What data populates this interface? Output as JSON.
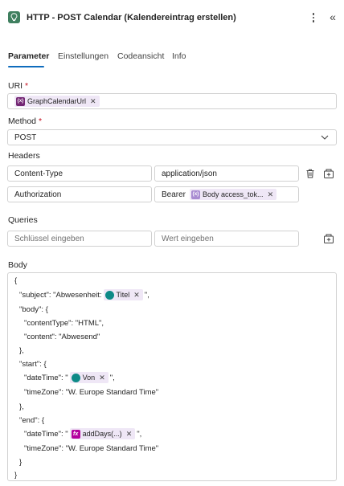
{
  "header": {
    "title": "HTTP  - POST Calendar (Kalendereintrag erstellen)",
    "action_icon": "lightbulb-icon",
    "more_icon": "more-vertical-icon",
    "collapse_glyph": "«"
  },
  "tabs": [
    {
      "label": "Parameter",
      "active": true
    },
    {
      "label": "Einstellungen",
      "active": false
    },
    {
      "label": "Codeansicht",
      "active": false
    },
    {
      "label": "Info",
      "active": false
    }
  ],
  "uri": {
    "label": "URI",
    "required_mark": "*",
    "token": {
      "label": "GraphCalendarUrl",
      "icon": "{x}"
    }
  },
  "method": {
    "label": "Method",
    "required_mark": "*",
    "value": "POST"
  },
  "headers": {
    "label": "Headers",
    "rows": [
      {
        "key": "Content-Type",
        "value": "application/json"
      },
      {
        "key": "Authorization",
        "value_prefix": "Bearer",
        "token": {
          "label": "Body access_tok...",
          "icon": "{x}"
        }
      }
    ]
  },
  "queries": {
    "label": "Queries",
    "key_placeholder": "Schlüssel eingeben",
    "value_placeholder": "Wert eingeben"
  },
  "body": {
    "label": "Body",
    "lines": {
      "l1": "{",
      "l2a": "\"subject\": \"Abwesenheit: ",
      "l2_token": "Titel",
      "l2b": " \",",
      "l3": "\"body\": {",
      "l4": "\"contentType\": \"HTML\",",
      "l5": "\"content\": \"Abwesend\"",
      "l6": "},",
      "l7": "\"start\": {",
      "l8a": "\"dateTime\": \"",
      "l8_token": "Von",
      "l8b": " \",",
      "l9": "\"timeZone\": \"W. Europe Standard Time\"",
      "l10": "},",
      "l11": "\"end\": {",
      "l12a": "\"dateTime\": \"",
      "l12_token": "addDays(...)",
      "l12b": " \",",
      "l13": "\"timeZone\": \"W. Europe Standard Time\"",
      "l14": "}",
      "l15": "}"
    }
  },
  "token_icon_labels": {
    "fx": "fx"
  },
  "colors": {
    "accent": "#0f6cbd",
    "variable_token": "#efe7f6",
    "action_icon": "#3f7f5f"
  }
}
